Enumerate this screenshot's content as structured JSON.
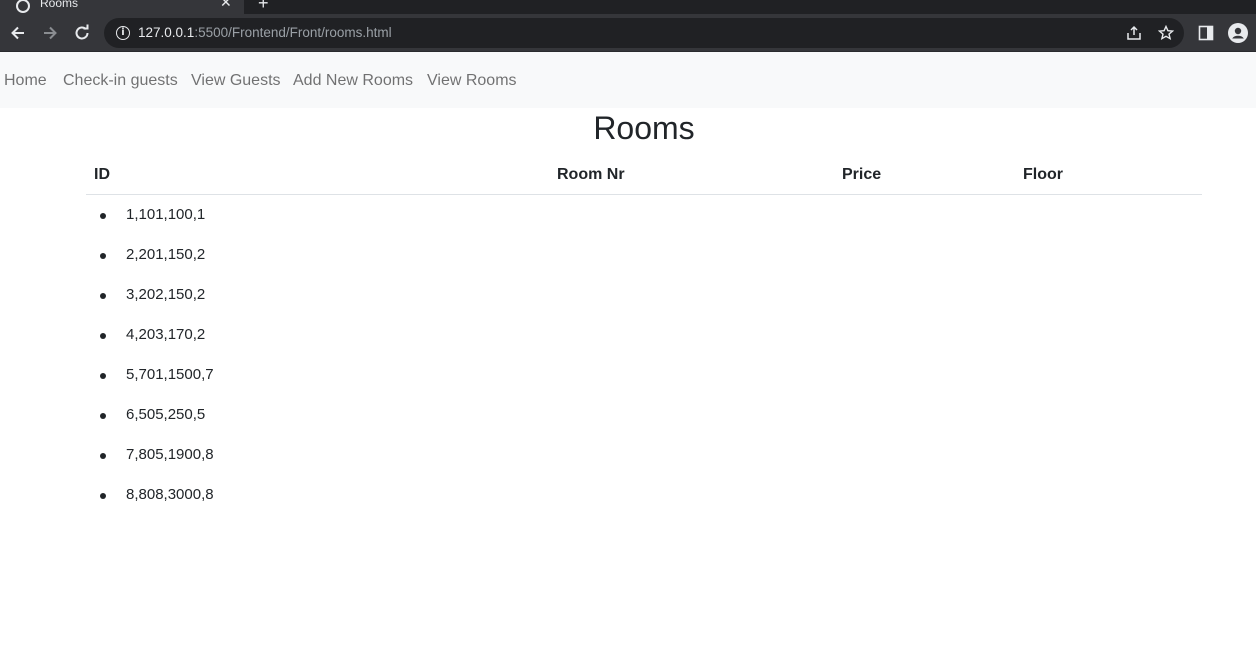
{
  "browser": {
    "tab_title": "Rooms",
    "url_host": "127.0.0.1",
    "url_path": ":5500/Frontend/Front/rooms.html"
  },
  "navbar": {
    "links": [
      "Home",
      "Check-in guests",
      "View Guests",
      "Add New Rooms",
      "View Rooms"
    ]
  },
  "page": {
    "title": "Rooms",
    "columns": [
      "ID",
      "Room Nr",
      "Price",
      "Floor"
    ],
    "rows": [
      "1,101,100,1",
      "2,201,150,2",
      "3,202,150,2",
      "4,203,170,2",
      "5,701,1500,7",
      "6,505,250,5",
      "7,805,1900,8",
      "8,808,3000,8"
    ]
  },
  "colors": {
    "chrome_dark": "#202124",
    "chrome_toolbar": "#35363a",
    "navbar_bg": "#f8f9fa",
    "text": "#212529"
  }
}
